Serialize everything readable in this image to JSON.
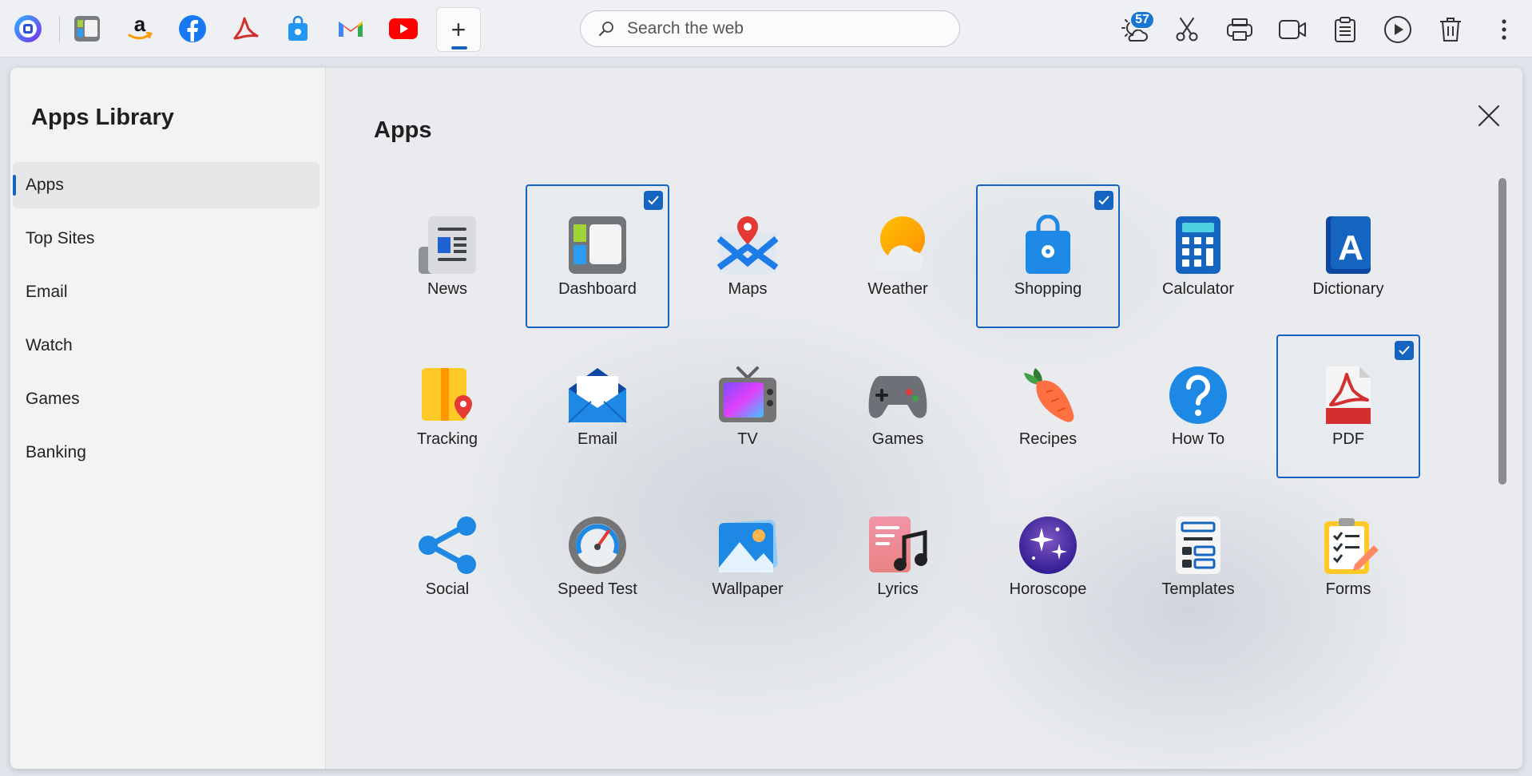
{
  "topbar": {
    "shortcuts": [
      {
        "name": "browser-logo-icon"
      },
      {
        "name": "dashboard-shortcut-icon"
      },
      {
        "name": "amazon-icon"
      },
      {
        "name": "facebook-icon"
      },
      {
        "name": "pdf-shortcut-icon"
      },
      {
        "name": "shopping-shortcut-icon"
      },
      {
        "name": "gmail-icon"
      },
      {
        "name": "youtube-icon"
      }
    ],
    "add_label": "+",
    "search": {
      "placeholder": "Search the web",
      "value": ""
    },
    "weather_badge": "57",
    "tools": [
      "weather-icon",
      "scissors-icon",
      "printer-icon",
      "video-icon",
      "clipboard-icon",
      "play-icon",
      "trash-icon",
      "more-icon"
    ]
  },
  "sidebar": {
    "title": "Apps Library",
    "items": [
      {
        "label": "Apps",
        "active": true
      },
      {
        "label": "Top Sites"
      },
      {
        "label": "Email"
      },
      {
        "label": "Watch"
      },
      {
        "label": "Games"
      },
      {
        "label": "Banking"
      }
    ]
  },
  "main": {
    "title": "Apps",
    "apps": [
      {
        "label": "News",
        "icon": "news-icon",
        "selected": false
      },
      {
        "label": "Dashboard",
        "icon": "dashboard-icon",
        "selected": true
      },
      {
        "label": "Maps",
        "icon": "maps-icon",
        "selected": false
      },
      {
        "label": "Weather",
        "icon": "weather-app-icon",
        "selected": false
      },
      {
        "label": "Shopping",
        "icon": "shopping-icon",
        "selected": true
      },
      {
        "label": "Calculator",
        "icon": "calculator-icon",
        "selected": false
      },
      {
        "label": "Dictionary",
        "icon": "dictionary-icon",
        "selected": false
      },
      {
        "label": "Tracking",
        "icon": "tracking-icon",
        "selected": false
      },
      {
        "label": "Email",
        "icon": "email-icon",
        "selected": false
      },
      {
        "label": "TV",
        "icon": "tv-icon",
        "selected": false
      },
      {
        "label": "Games",
        "icon": "games-icon",
        "selected": false
      },
      {
        "label": "Recipes",
        "icon": "recipes-icon",
        "selected": false
      },
      {
        "label": "How To",
        "icon": "how-to-icon",
        "selected": false
      },
      {
        "label": "PDF",
        "icon": "pdf-icon",
        "selected": true
      },
      {
        "label": "Social",
        "icon": "social-icon",
        "selected": false
      },
      {
        "label": "Speed Test",
        "icon": "speed-test-icon",
        "selected": false
      },
      {
        "label": "Wallpaper",
        "icon": "wallpaper-icon",
        "selected": false
      },
      {
        "label": "Lyrics",
        "icon": "lyrics-icon",
        "selected": false
      },
      {
        "label": "Horoscope",
        "icon": "horoscope-icon",
        "selected": false
      },
      {
        "label": "Templates",
        "icon": "templates-icon",
        "selected": false
      },
      {
        "label": "Forms",
        "icon": "forms-icon",
        "selected": false
      }
    ]
  },
  "colors": {
    "accent": "#1565c0",
    "badge": "#1976d2"
  }
}
